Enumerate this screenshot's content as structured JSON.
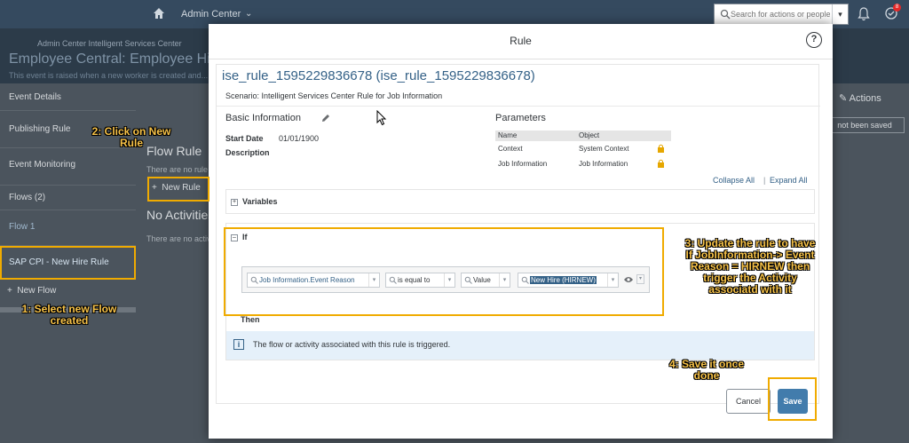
{
  "shell": {
    "app_title": "Admin Center",
    "search_placeholder": "Search for actions or people",
    "notification_count": "8"
  },
  "page": {
    "breadcrumb": "Admin Center  Intelligent Services Center",
    "title": "Employee Central: Employee Hire",
    "subtitle": "This event is raised when a new worker is created and..."
  },
  "leftnav": {
    "event_details": "Event Details",
    "publishing_rule": "Publishing Rule",
    "event_monitoring": "Event Monitoring",
    "flows": "Flows (2)",
    "flow1": "Flow 1",
    "selected_flow": "SAP CPI - New Hire Rule",
    "new_flow": "New Flow"
  },
  "main": {
    "flow_rule_title": "Flow Rule",
    "no_rule_text": "There are no rule",
    "new_rule": "New Rule",
    "no_activities_title": "No Activities",
    "no_activities_text": "There are no activ",
    "actions": "Actions",
    "not_saved": "not been saved"
  },
  "modal": {
    "title": "Rule",
    "rule_name": "ise_rule_1595229836678 (ise_rule_1595229836678)",
    "scenario": "Scenario: Intelligent Services Center Rule for Job Information",
    "basic_info": "Basic Information",
    "start_date_label": "Start Date",
    "start_date_value": "01/01/1900",
    "description_label": "Description",
    "parameters_title": "Parameters",
    "param_cols": [
      "Name",
      "Object"
    ],
    "param_rows": [
      {
        "name": "Context",
        "object": "System Context"
      },
      {
        "name": "Job Information",
        "object": "Job Information"
      }
    ],
    "collapse_all": "Collapse All",
    "expand_all": "Expand All",
    "variables": "Variables",
    "if_label": "If",
    "condition": {
      "field": "Job Information.Event Reason",
      "operator": "is equal to",
      "type": "Value",
      "value": "New Hire (HIRNEW)"
    },
    "then_label": "Then",
    "info_text": "The flow or activity associated with this rule is triggered.",
    "cancel": "Cancel",
    "save": "Save"
  },
  "annotations": {
    "a1": "1: Select new Flow created",
    "a2": "2: Click on New Rule",
    "a3": "3: Update the rule to have If JobInformation-> Event Reason = HIRNEW then trigger the Activity associatd with it",
    "a4": "4: Save it once done"
  },
  "colors": {
    "accent": "#346187",
    "highlight": "#f0ab00",
    "save_button": "#427cac"
  }
}
